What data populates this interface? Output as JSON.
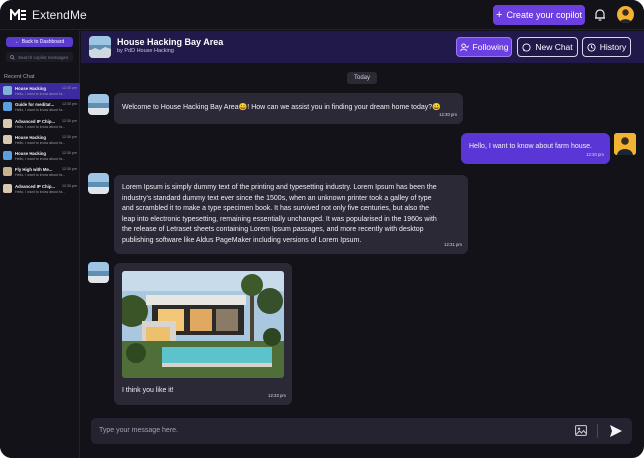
{
  "brand": {
    "name": "ExtendMe"
  },
  "topbar": {
    "create_label": "Create your copilot"
  },
  "sidebar": {
    "back_label": "Back to Dashboard",
    "search_placeholder": "Search copilot messages",
    "recent_label": "Recent Chat",
    "chats": [
      {
        "title": "House Hacking",
        "preview": "Hello, I want to know about fa...",
        "time": "12:30 pm",
        "active": true
      },
      {
        "title": "Guide for meditat...",
        "preview": "Hello, I want to know about fa...",
        "time": "12:30 pm",
        "active": false
      },
      {
        "title": "Advanced IP Chip...",
        "preview": "Hello, I want to know about fa...",
        "time": "12:30 pm",
        "active": false
      },
      {
        "title": "House Hacking",
        "preview": "Hello, I want to know about fa...",
        "time": "12:30 pm",
        "active": false
      },
      {
        "title": "House Hacking",
        "preview": "Hello, I want to know about fa...",
        "time": "12:30 pm",
        "active": false
      },
      {
        "title": "Fly High with Me...",
        "preview": "Hello, I want to know about fa...",
        "time": "12:30 pm",
        "active": false
      },
      {
        "title": "Advanced IP Chip...",
        "preview": "Hello, I want to know about fa...",
        "time": "12:30 pm",
        "active": false
      }
    ]
  },
  "header": {
    "title": "House Hacking Bay Area",
    "subtitle": "by PdD House Hacking",
    "following_label": "Following",
    "newchat_label": "New Chat",
    "history_label": "History"
  },
  "conversation": {
    "date_label": "Today",
    "messages": [
      {
        "from": "bot",
        "text": "Welcome to House Hacking Bay Area😀! How can we assist you in finding your dream home today?😀",
        "time": "12:30 pm"
      },
      {
        "from": "user",
        "text": "Hello, I want to know about farm house.",
        "time": "12:30 pm"
      },
      {
        "from": "bot",
        "lines": [
          "Lorem Ipsum is simply dummy text of the printing and typesetting industry. Lorem Ipsum has been the",
          "industry's standard dummy text ever since the 1500s, when an unknown printer took a galley of type",
          "and scrambled it to make a type specimen book. It has survived not only five centuries, but also the",
          "leap into electronic typesetting, remaining essentially unchanged. It was popularised in the 1960s with",
          "the release of Letraset sheets containing Lorem Ipsum passages, and more recently with desktop",
          "publishing software like Aldus PageMaker including versions of Lorem Ipsum."
        ],
        "time": "12:31 pm"
      },
      {
        "from": "bot",
        "text": "I think you like it!",
        "time": "12:33 pm"
      }
    ]
  },
  "composer": {
    "placeholder": "Type your message here."
  },
  "colors": {
    "accent": "#6b3fe0",
    "user_bubble": "#5b36d6",
    "bot_bubble": "#2b2935",
    "header_bg": "#21194a",
    "background": "#121218"
  },
  "icons": [
    "extendme-logo-icon",
    "plus-icon",
    "bell-icon",
    "user-avatar",
    "back-arrow-icon",
    "search-icon",
    "following-icon",
    "chat-bubble-icon",
    "history-icon",
    "image-attach-icon",
    "send-icon"
  ]
}
